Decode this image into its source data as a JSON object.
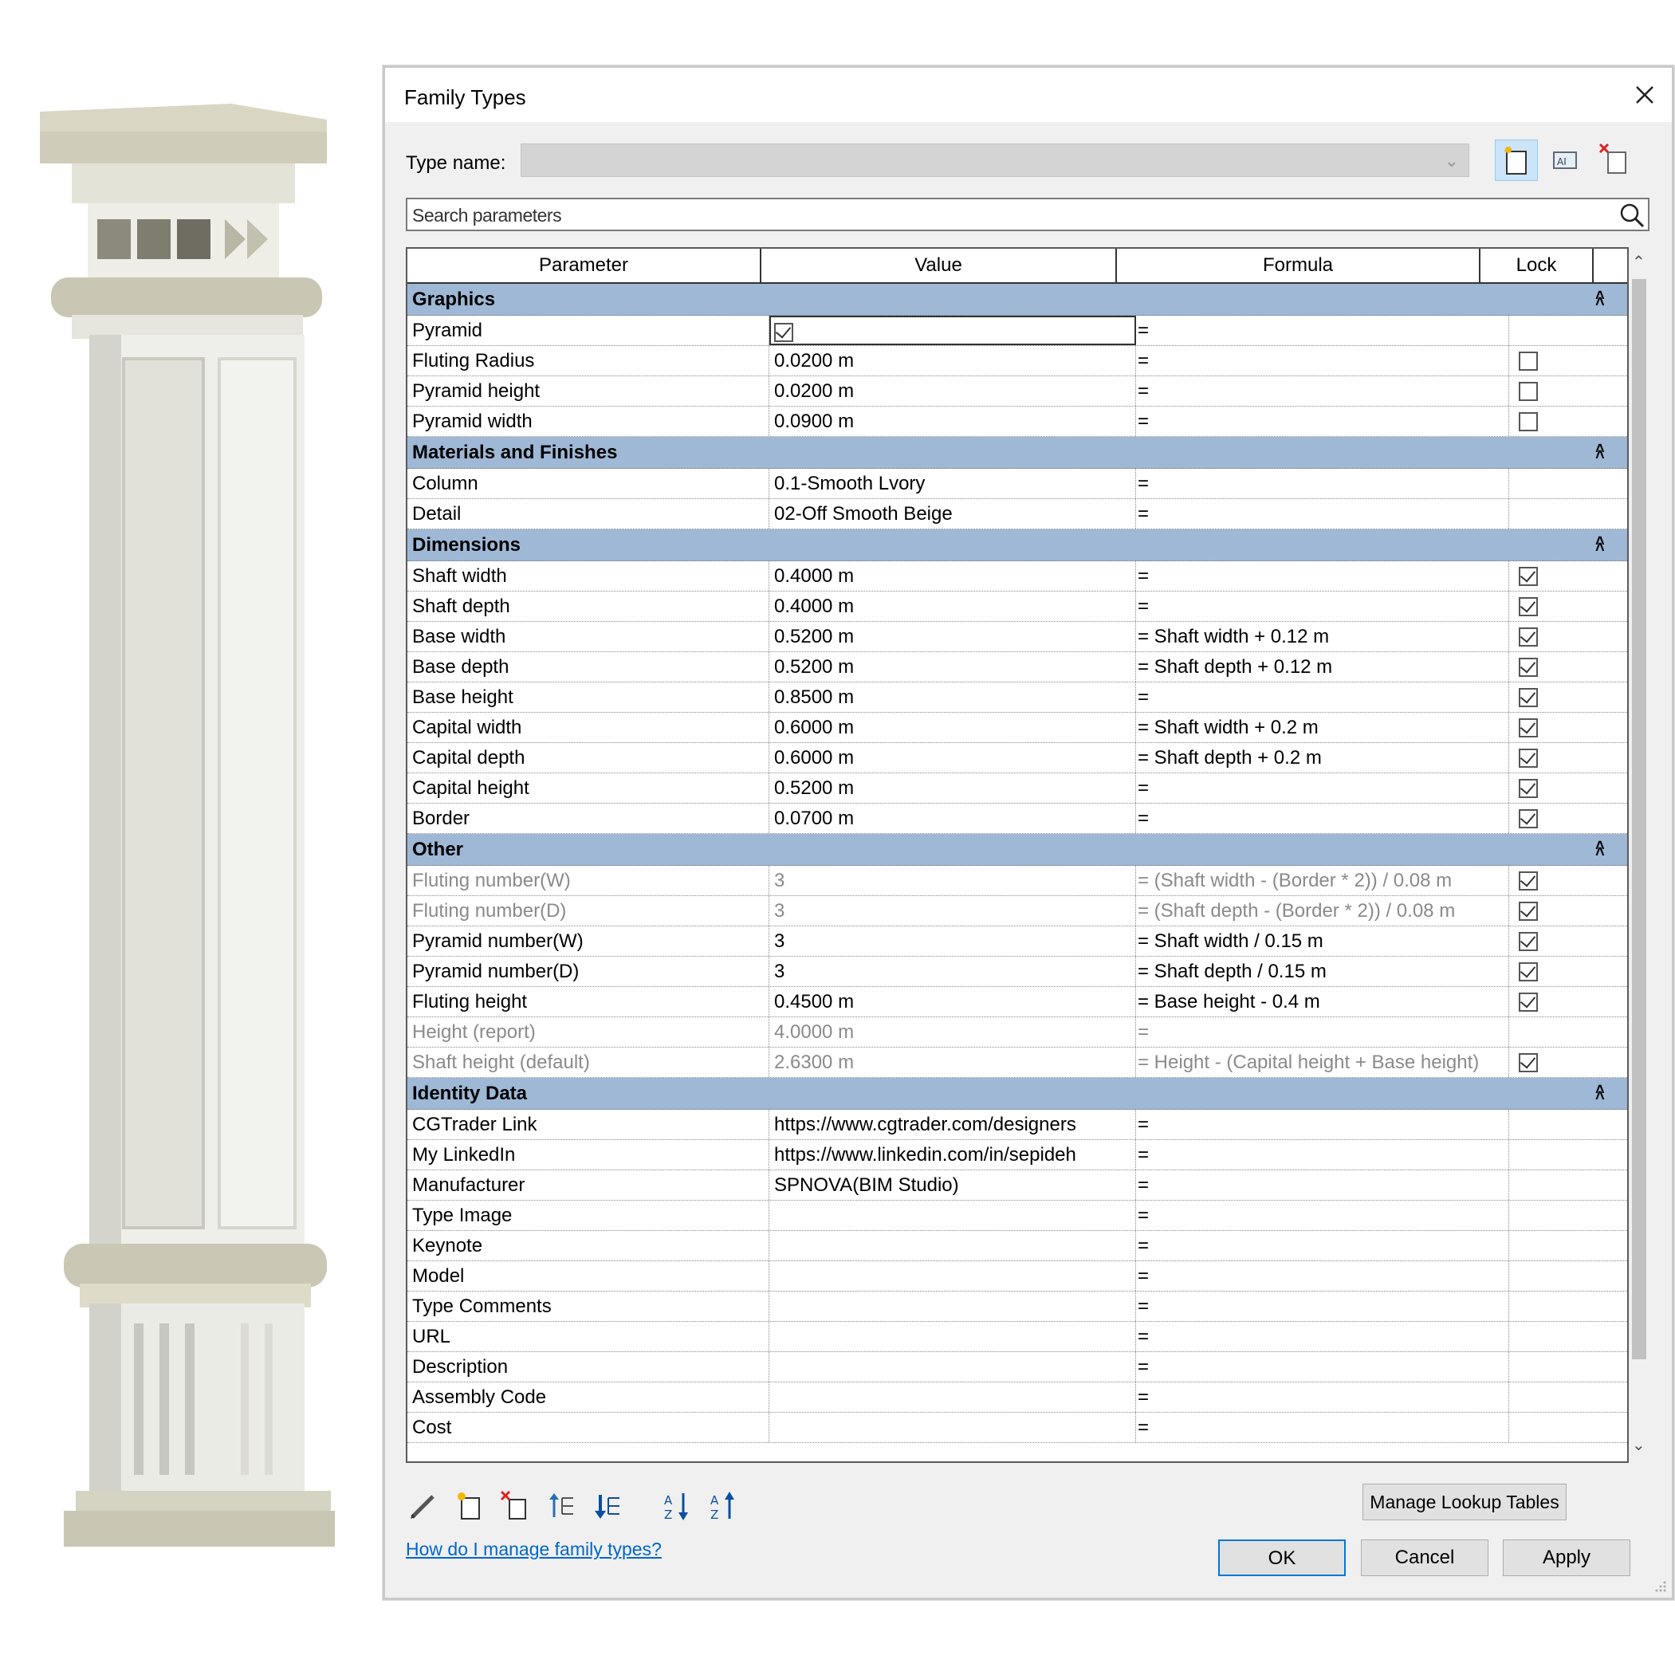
{
  "dialog": {
    "title": "Family Types",
    "type_name_label": "Type name:",
    "type_name_value": "",
    "search_placeholder": "Search parameters"
  },
  "columns": {
    "parameter": "Parameter",
    "value": "Value",
    "formula": "Formula",
    "lock": "Lock"
  },
  "groups": [
    {
      "name": "Graphics",
      "rows": [
        {
          "param": "Pyramid",
          "value_checkbox": true,
          "formula": "=",
          "lock": null,
          "focused": true
        },
        {
          "param": "Fluting Radius",
          "value": "0.0200 m",
          "formula": "=",
          "lock": false
        },
        {
          "param": "Pyramid height",
          "value": "0.0200 m",
          "formula": "=",
          "lock": false
        },
        {
          "param": "Pyramid width",
          "value": "0.0900 m",
          "formula": "=",
          "lock": false
        }
      ]
    },
    {
      "name": "Materials and Finishes",
      "rows": [
        {
          "param": "Column",
          "value": "0.1-Smooth Lvory",
          "formula": "=",
          "lock": null
        },
        {
          "param": "Detail",
          "value": "02-Off Smooth Beige",
          "formula": "=",
          "lock": null
        }
      ]
    },
    {
      "name": "Dimensions",
      "rows": [
        {
          "param": "Shaft width",
          "value": "0.4000 m",
          "formula": "=",
          "lock": true
        },
        {
          "param": "Shaft depth",
          "value": "0.4000 m",
          "formula": "=",
          "lock": true
        },
        {
          "param": "Base width",
          "value": "0.5200 m",
          "formula": "= Shaft width + 0.12 m",
          "lock": true
        },
        {
          "param": "Base depth",
          "value": "0.5200 m",
          "formula": "= Shaft depth + 0.12 m",
          "lock": true
        },
        {
          "param": "Base height",
          "value": "0.8500 m",
          "formula": "=",
          "lock": true
        },
        {
          "param": "Capital width",
          "value": "0.6000 m",
          "formula": "= Shaft width + 0.2 m",
          "lock": true
        },
        {
          "param": "Capital depth",
          "value": "0.6000 m",
          "formula": "= Shaft depth + 0.2 m",
          "lock": true
        },
        {
          "param": "Capital height",
          "value": "0.5200 m",
          "formula": "=",
          "lock": true
        },
        {
          "param": "Border",
          "value": "0.0700 m",
          "formula": "=",
          "lock": true
        }
      ]
    },
    {
      "name": "Other",
      "rows": [
        {
          "param": "Fluting number(W)",
          "value": "3",
          "formula": "= (Shaft width - (Border * 2)) / 0.08 m",
          "lock": true,
          "grey": true
        },
        {
          "param": "Fluting number(D)",
          "value": "3",
          "formula": "= (Shaft depth - (Border * 2)) / 0.08 m",
          "lock": true,
          "grey": true
        },
        {
          "param": "Pyramid number(W)",
          "value": "3",
          "formula": "= Shaft width / 0.15 m",
          "lock": true
        },
        {
          "param": "Pyramid number(D)",
          "value": "3",
          "formula": "= Shaft depth / 0.15 m",
          "lock": true
        },
        {
          "param": "Fluting height",
          "value": "0.4500 m",
          "formula": "= Base height - 0.4 m",
          "lock": true
        },
        {
          "param": "Height (report)",
          "value": "4.0000 m",
          "formula": "=",
          "lock": null,
          "grey": true
        },
        {
          "param": "Shaft height (default)",
          "value": "2.6300 m",
          "formula": "= Height - (Capital height + Base height)",
          "lock": true,
          "grey": true
        }
      ]
    },
    {
      "name": "Identity Data",
      "rows": [
        {
          "param": "CGTrader Link",
          "value": "https://www.cgtrader.com/designers",
          "formula": "=",
          "lock": null
        },
        {
          "param": "My LinkedIn",
          "value": "https://www.linkedin.com/in/sepideh",
          "formula": "=",
          "lock": null
        },
        {
          "param": "Manufacturer",
          "value": "SPNOVA(BIM Studio)",
          "formula": "=",
          "lock": null
        },
        {
          "param": "Type Image",
          "value": "",
          "formula": "=",
          "lock": null
        },
        {
          "param": "Keynote",
          "value": "",
          "formula": "=",
          "lock": null
        },
        {
          "param": "Model",
          "value": "",
          "formula": "=",
          "lock": null
        },
        {
          "param": "Type Comments",
          "value": "",
          "formula": "=",
          "lock": null
        },
        {
          "param": "URL",
          "value": "",
          "formula": "=",
          "lock": null
        },
        {
          "param": "Description",
          "value": "",
          "formula": "=",
          "lock": null
        },
        {
          "param": "Assembly Code",
          "value": "",
          "formula": "=",
          "lock": null
        },
        {
          "param": "Cost",
          "value": "",
          "formula": "=",
          "lock": null
        }
      ]
    }
  ],
  "bottom": {
    "manage_lookup": "Manage Lookup Tables",
    "help_link": "How do I manage family types?",
    "ok": "OK",
    "cancel": "Cancel",
    "apply": "Apply"
  }
}
